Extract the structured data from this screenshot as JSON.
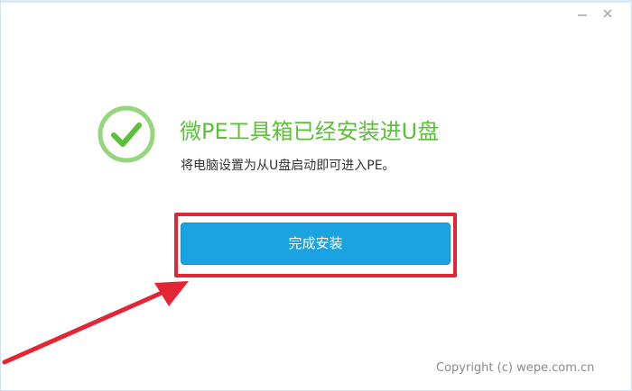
{
  "window": {
    "controls": {
      "minimize_icon": "minimize-icon",
      "close_icon": "close-icon"
    }
  },
  "main": {
    "icon": "check-circle-icon",
    "headline": "微PE工具箱已经安装进U盘",
    "subline": "将电脑设置为从U盘启动即可进入PE。",
    "finish_button_label": "完成安装"
  },
  "annotation": {
    "highlight_color": "#e32636",
    "arrow_color": "#e32636"
  },
  "footer": {
    "copyright": "Copyright (c) wepe.com.cn"
  },
  "colors": {
    "accent_green": "#5cbf3a",
    "button_blue": "#1aa3e0"
  }
}
